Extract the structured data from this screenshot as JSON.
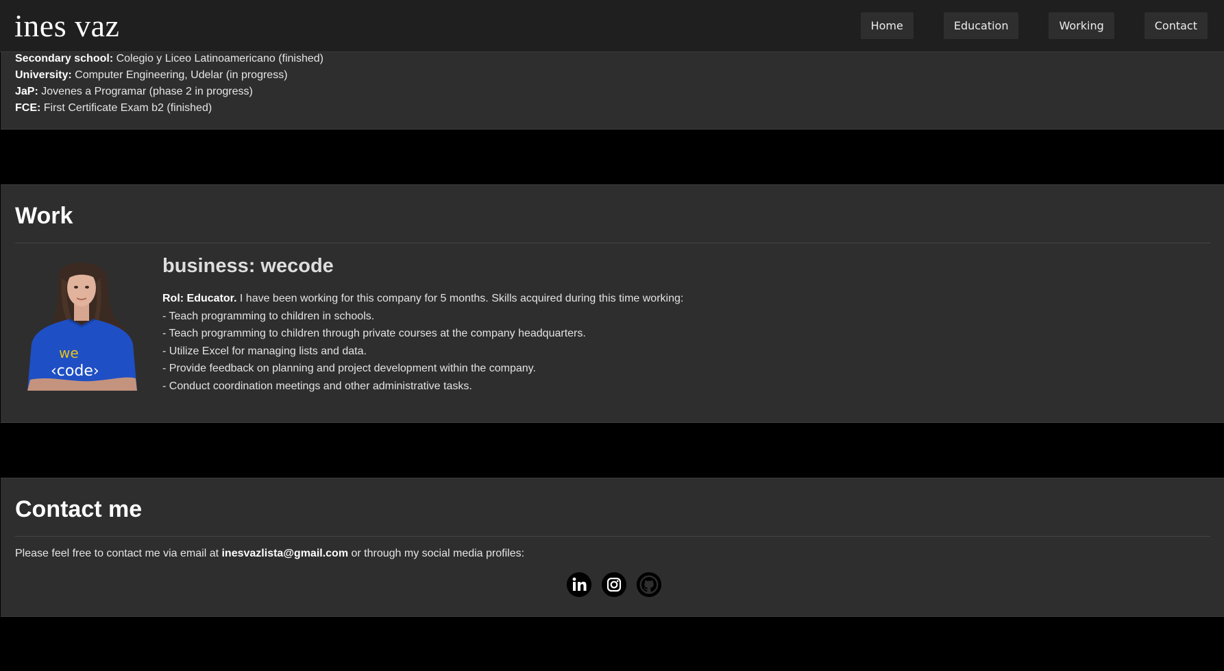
{
  "header": {
    "brand": "ines vaz",
    "nav": [
      "Home",
      "Education",
      "Working",
      "Contact"
    ]
  },
  "education": {
    "items": [
      {
        "label": "Secondary school:",
        "value": " Colegio y Liceo Latinoamericano (finished)"
      },
      {
        "label": "University:",
        "value": " Computer Engineering, Udelar (in progress)"
      },
      {
        "label": "JaP:",
        "value": " Jovenes a Programar (phase 2 in progress)"
      },
      {
        "label": "FCE:",
        "value": " First Certificate Exam b2 (finished)"
      }
    ]
  },
  "work": {
    "title": "Work",
    "photo_text": [
      "we",
      "‹code›"
    ],
    "business": "business: wecode",
    "role_label": "Rol: Educator.",
    "role_text": " I have been working for this company for 5 months. Skills acquired during this time working:",
    "skills": [
      "- Teach programming to children in schools.",
      "- Teach programming to children through private courses at the company headquarters.",
      "- Utilize Excel for managing lists and data.",
      "- Provide feedback on planning and project development within the company.",
      "- Conduct coordination meetings and other administrative tasks."
    ]
  },
  "contact": {
    "title": "Contact me",
    "text_before": "Please feel free to contact me via email at ",
    "email": "inesvazlista@gmail.com",
    "text_after": " or through my social media profiles:",
    "socials": [
      "linkedin-icon",
      "instagram-icon",
      "github-icon"
    ]
  },
  "colors": {
    "page_bg": "#000000",
    "section_bg": "#2e2e2e",
    "header_bg": "#1f1f1f",
    "nav_button_bg": "#2e2e2e",
    "shirt_blue": "#1f4fc4",
    "logo_yellow": "#e8c21c"
  }
}
